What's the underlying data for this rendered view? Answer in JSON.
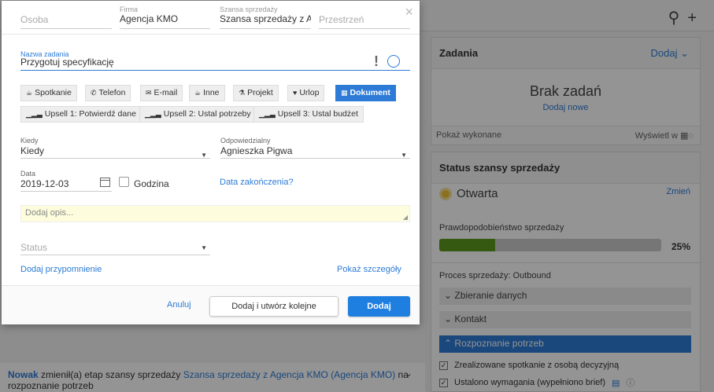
{
  "modal": {
    "person_placeholder": "Osoba",
    "company_label": "Firma",
    "company_value": "Agencja KMO",
    "opportunity_label": "Szansa sprzedaży",
    "opportunity_value": "Szansa sprzedaży z Ag",
    "space_placeholder": "Przestrzeń",
    "close": "×",
    "task_name_label": "Nazwa zadania",
    "task_name_value": "Przygotuj specyfikację",
    "priority": "!",
    "types": [
      {
        "label": "Spotkanie",
        "icon": "meeting-icon"
      },
      {
        "label": "Telefon",
        "icon": "phone-icon"
      },
      {
        "label": "E-mail",
        "icon": "mail-icon"
      },
      {
        "label": "Inne",
        "icon": "other-icon"
      },
      {
        "label": "Projekt",
        "icon": "flask-icon"
      },
      {
        "label": "Urlop",
        "icon": "heart-icon"
      },
      {
        "label": "Dokument",
        "icon": "table-icon",
        "selected": true
      },
      {
        "label": "Upsell 1: Potwierdź dane",
        "icon": "signal-icon"
      },
      {
        "label": "Upsell 2: Ustal potrzeby",
        "icon": "signal-icon"
      },
      {
        "label": "Upsell 3: Ustal budżet",
        "icon": "signal-icon"
      }
    ],
    "when_label": "Kiedy",
    "when_value": "Kiedy",
    "responsible_label": "Odpowiedzialny",
    "responsible_value": "Agnieszka Pigwa",
    "date_label": "Data",
    "date_value": "2019-12-03",
    "time_label": "Godzina",
    "end_date_link": "Data zakończenia?",
    "description_placeholder": "Dodaj opis...",
    "status_placeholder": "Status",
    "add_reminder": "Dodaj przypomnienie",
    "show_details": "Pokaż szczegóły",
    "cancel": "Anuluj",
    "add_and_next": "Dodaj i utwórz kolejne",
    "add": "Dodaj"
  },
  "tasks_panel": {
    "title": "Zadania",
    "action": "Dodaj",
    "empty_title": "Brak zadań",
    "empty_link": "Dodaj nowe",
    "show_done": "Pokaż wykonane",
    "show_in": "Wyświetl w"
  },
  "status_panel": {
    "title": "Status szansy sprzedaży",
    "state": "Otwarta",
    "change": "Zmień",
    "probability_label": "Prawdopodobieństwo sprzedaży",
    "probability": 25,
    "probability_text": "25%",
    "process": "Proces sprzedaży: Outbound",
    "stages": [
      {
        "label": "Zbieranie danych",
        "active": false
      },
      {
        "label": "Kontakt",
        "active": false
      },
      {
        "label": "Rozpoznanie potrzeb",
        "active": true
      }
    ],
    "checklist": [
      {
        "label": "Zrealizowane spotkanie z osobą decyzyjną",
        "checked": true
      },
      {
        "label": "Ustalono wymagania (wypełniono brief)",
        "checked": true
      }
    ]
  },
  "activity": {
    "user": "Nowak",
    "text1": " zmienił(a) etap szansy sprzedaży ",
    "link": "Szansa sprzedaży z Agencja KMO (Agencja KMO)",
    "text2": " na",
    "text3": "rozpoznanie potrzeb"
  },
  "colors": {
    "accent": "#2d7bd6",
    "primary_button": "#1e7fe0",
    "progress": "#5c9a1d",
    "state_dot": "#f0c23a"
  }
}
